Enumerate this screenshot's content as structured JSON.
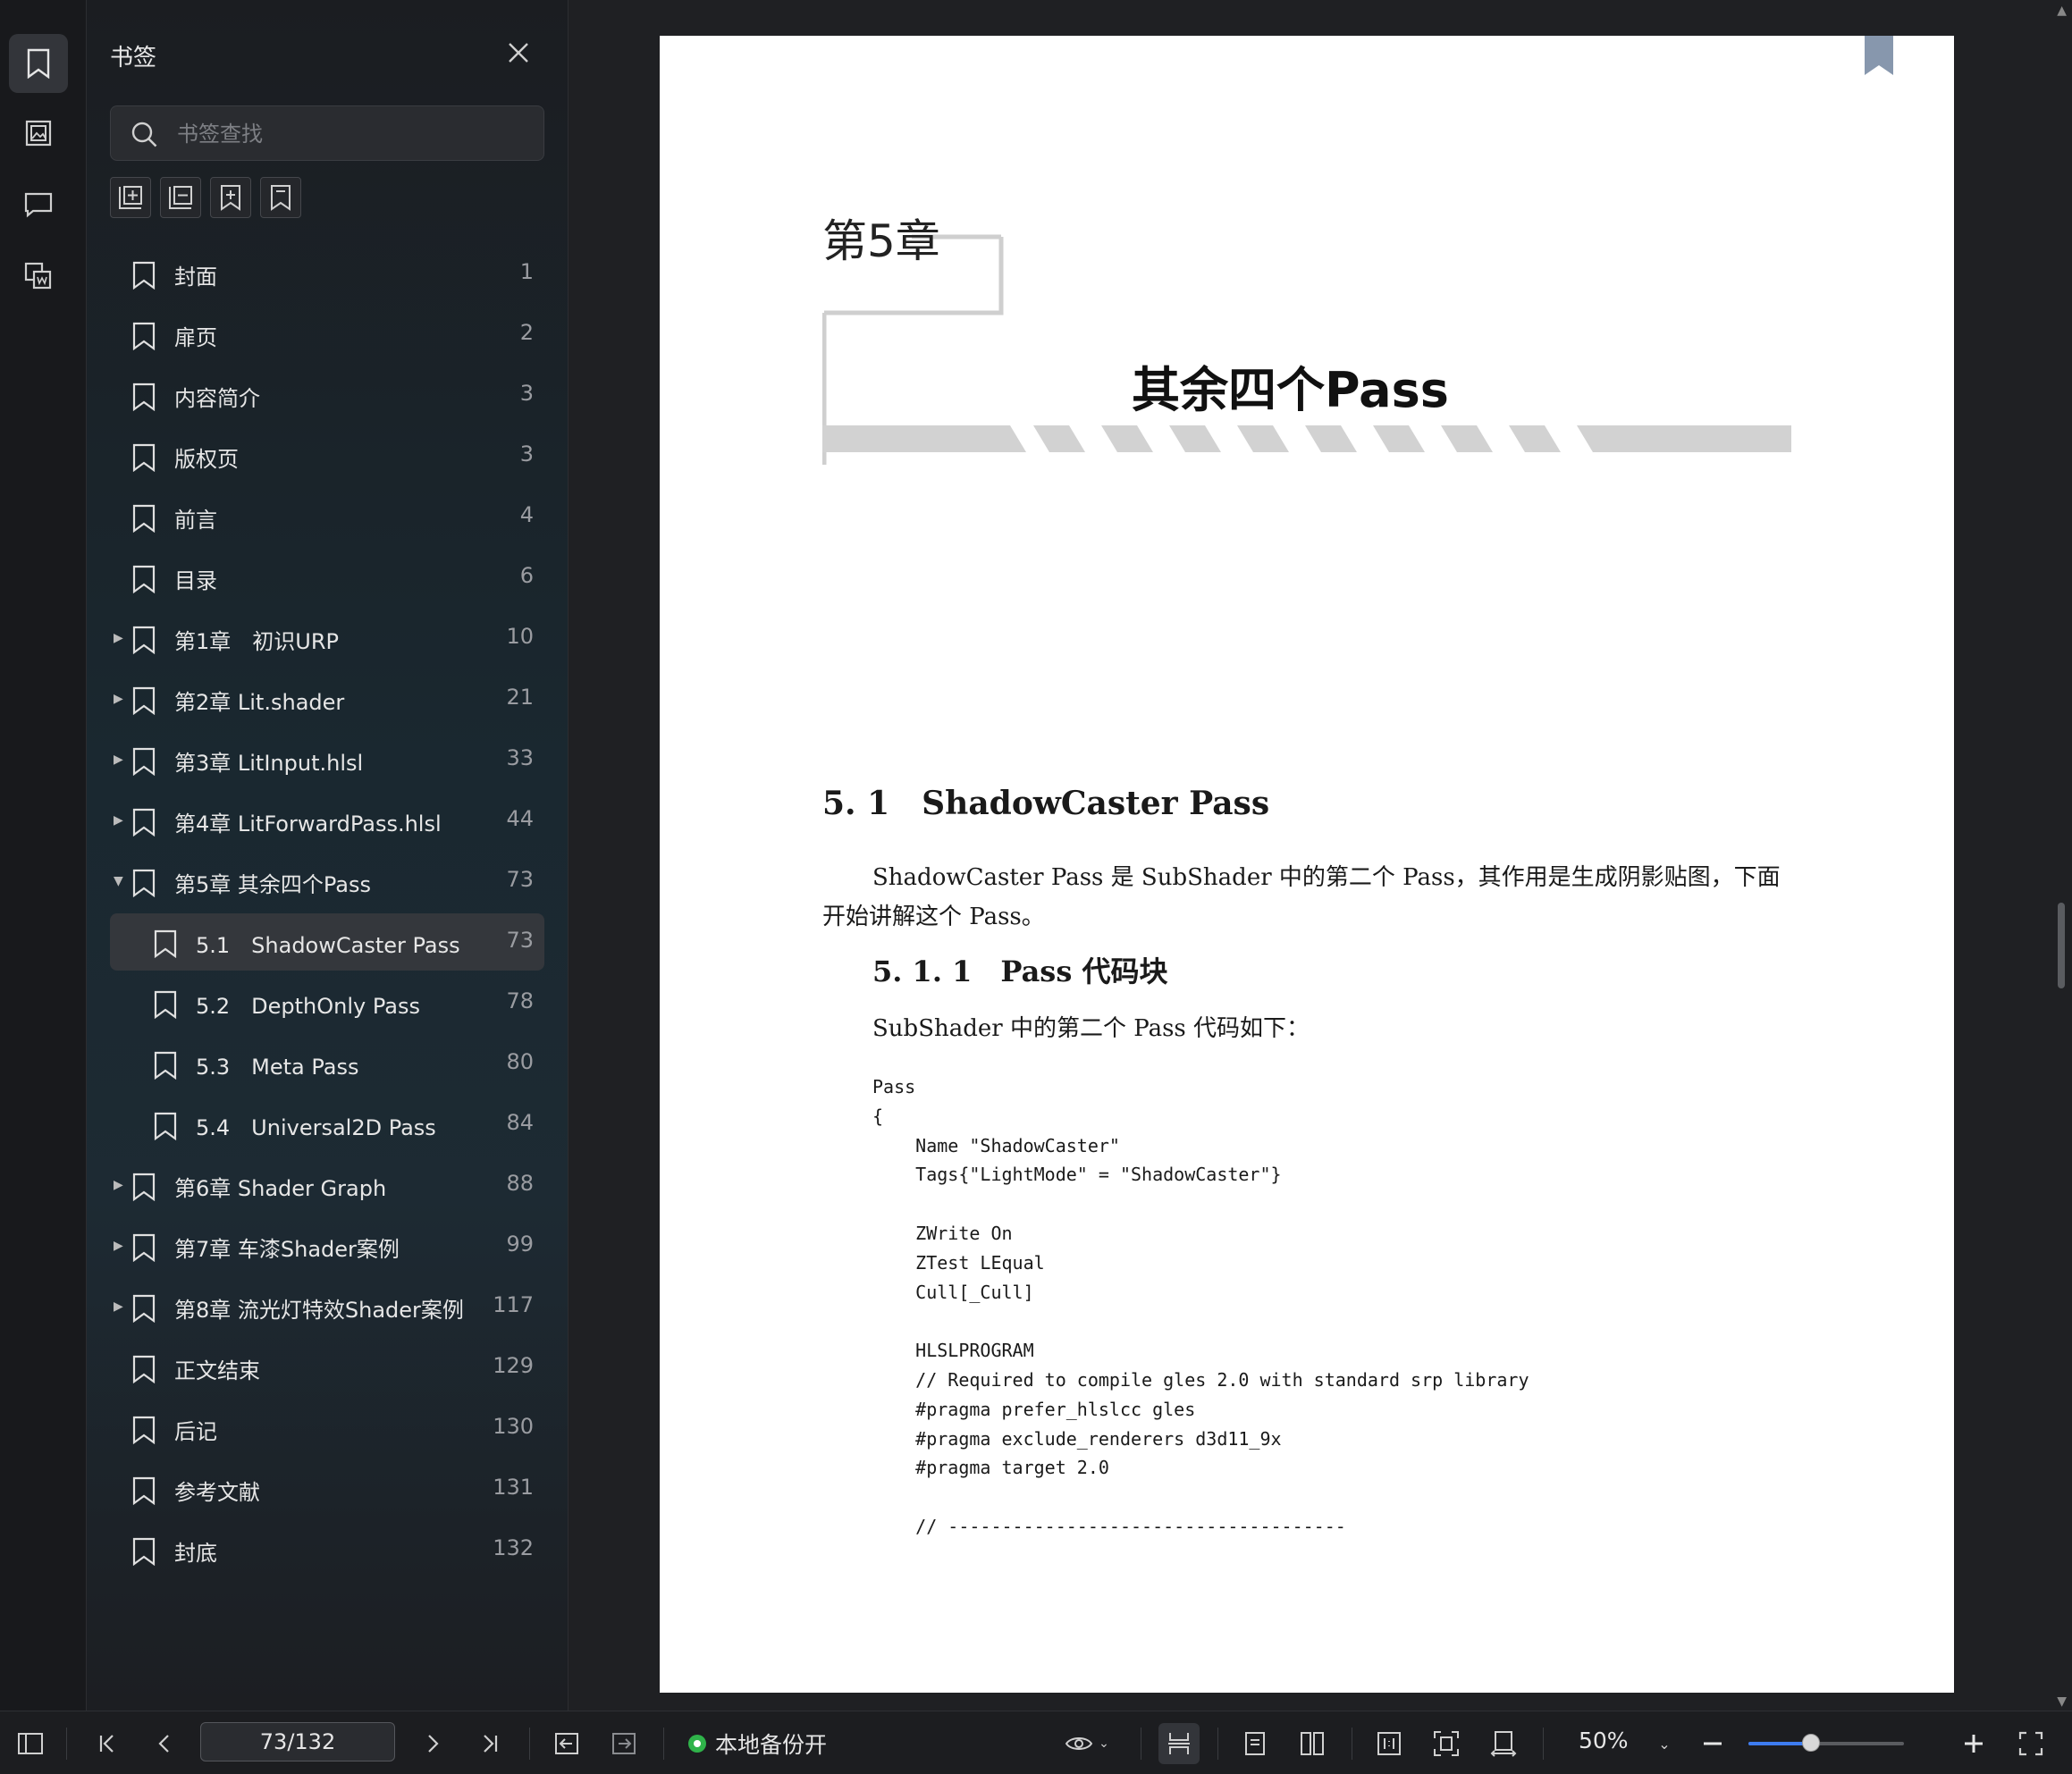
{
  "sidebar": {
    "title": "书签",
    "search_placeholder": "书签查找",
    "bookmarks": [
      {
        "label": "封面",
        "page": "1",
        "level": 0,
        "expand": "none"
      },
      {
        "label": "扉页",
        "page": "2",
        "level": 0,
        "expand": "none"
      },
      {
        "label": "内容简介",
        "page": "3",
        "level": 0,
        "expand": "none"
      },
      {
        "label": "版权页",
        "page": "3",
        "level": 0,
        "expand": "none"
      },
      {
        "label": "前言",
        "page": "4",
        "level": 0,
        "expand": "none"
      },
      {
        "label": "目录",
        "page": "6",
        "level": 0,
        "expand": "none"
      },
      {
        "label": "第1章　初识URP",
        "page": "10",
        "level": 0,
        "expand": "collapsed"
      },
      {
        "label": "第2章 Lit.shader",
        "page": "21",
        "level": 0,
        "expand": "collapsed"
      },
      {
        "label": "第3章 LitInput.hlsl",
        "page": "33",
        "level": 0,
        "expand": "collapsed"
      },
      {
        "label": "第4章 LitForwardPass.hlsl",
        "page": "44",
        "level": 0,
        "expand": "collapsed"
      },
      {
        "label": "第5章 其余四个Pass",
        "page": "73",
        "level": 0,
        "expand": "expanded"
      },
      {
        "label": "5.1　ShadowCaster Pass",
        "page": "73",
        "level": 1,
        "expand": "none",
        "selected": true
      },
      {
        "label": "5.2　DepthOnly Pass",
        "page": "78",
        "level": 1,
        "expand": "none"
      },
      {
        "label": "5.3　Meta Pass",
        "page": "80",
        "level": 1,
        "expand": "none"
      },
      {
        "label": "5.4　Universal2D Pass",
        "page": "84",
        "level": 1,
        "expand": "none"
      },
      {
        "label": "第6章 Shader Graph",
        "page": "88",
        "level": 0,
        "expand": "collapsed"
      },
      {
        "label": "第7章 车漆Shader案例",
        "page": "99",
        "level": 0,
        "expand": "collapsed"
      },
      {
        "label": "第8章 流光灯特效Shader案例",
        "page": "117",
        "level": 0,
        "expand": "collapsed"
      },
      {
        "label": "正文结束",
        "page": "129",
        "level": 0,
        "expand": "none"
      },
      {
        "label": "后记",
        "page": "130",
        "level": 0,
        "expand": "none"
      },
      {
        "label": "参考文献",
        "page": "131",
        "level": 0,
        "expand": "none"
      },
      {
        "label": "封底",
        "page": "132",
        "level": 0,
        "expand": "none"
      }
    ]
  },
  "document": {
    "chapter_number": "第5章",
    "chapter_title": "其余四个Pass",
    "section_heading": "5. 1　ShadowCaster Pass",
    "section_paragraph": "ShadowCaster Pass 是 SubShader 中的第二个 Pass，其作用是生成阴影贴图，下面开始讲解这个 Pass。",
    "subsection_heading": "5. 1. 1　Pass 代码块",
    "subsection_paragraph": "SubShader 中的第二个 Pass 代码如下：",
    "code": "Pass\n{\n    Name \"ShadowCaster\"\n    Tags{\"LightMode\" = \"ShadowCaster\"}\n\n    ZWrite On\n    ZTest LEqual\n    Cull[_Cull]\n\n    HLSLPROGRAM\n    // Required to compile gles 2.0 with standard srp library\n    #pragma prefer_hlslcc gles\n    #pragma exclude_renderers d3d11_9x\n    #pragma target 2.0\n\n    // -------------------------------------"
  },
  "statusbar": {
    "page_indicator": "73/132",
    "backup_label": "本地备份开",
    "zoom_label": "50%",
    "zoom_fraction": 0.4
  },
  "colors": {
    "accent": "#3d7cf0",
    "backup_green": "#2fb34a",
    "ribbon": "#8797ad",
    "selected_row": "#34373c"
  }
}
